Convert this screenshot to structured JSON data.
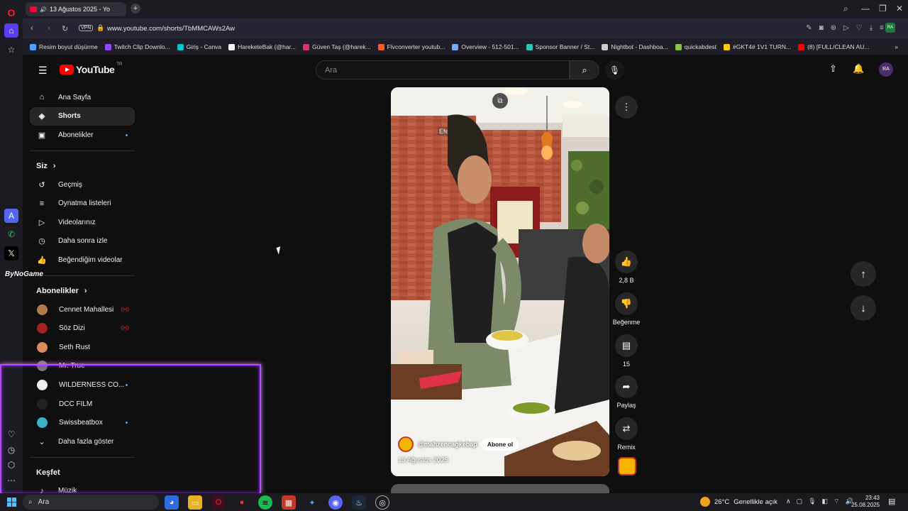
{
  "browser": {
    "tab_title": "13 Ağustos 2025 - Yo",
    "url": "www.youtube.com/shorts/TbMMCAWs2Aw",
    "vpn_label": "VPN",
    "bookmarks": [
      {
        "label": "Resim boyut düşürme",
        "color": "#4aa3ff"
      },
      {
        "label": "Twitch Clip Downlo...",
        "color": "#9146ff"
      },
      {
        "label": "Giriş - Canva",
        "color": "#00c4cc"
      },
      {
        "label": "HareketeBak (@har...",
        "color": "#ffffff"
      },
      {
        "label": "Güven Taş (@harek...",
        "color": "#e1306c"
      },
      {
        "label": "Flvconverter youtub...",
        "color": "#ff5a2a"
      },
      {
        "label": "Overview - 512-501...",
        "color": "#7aa8ff"
      },
      {
        "label": "Sponsor Banner / St...",
        "color": "#2ec4b6"
      },
      {
        "label": "Nightbot - Dashboa...",
        "color": "#cccccc"
      },
      {
        "label": "quickabdest",
        "color": "#8bc34a"
      },
      {
        "label": "#GKT4# 1V1 TURN...",
        "color": "#ffcc00"
      },
      {
        "label": "(8) [FULL/CLEAN AU...",
        "color": "#ff0000"
      }
    ]
  },
  "youtube": {
    "logo_text": "YouTube",
    "logo_region": "TR",
    "search_placeholder": "Ara",
    "avatar_initials": "RA",
    "sidebar": {
      "main": [
        {
          "label": "Ana Sayfa",
          "icon": "home-icon",
          "glyph": "⌂"
        },
        {
          "label": "Shorts",
          "icon": "shorts-icon",
          "glyph": "◈",
          "active": true
        },
        {
          "label": "Abonelikler",
          "icon": "subscriptions-icon",
          "glyph": "▣",
          "dot": true
        }
      ],
      "you_title": "Siz",
      "you": [
        {
          "label": "Geçmiş",
          "icon": "history-icon",
          "glyph": "↺"
        },
        {
          "label": "Oynatma listeleri",
          "icon": "playlists-icon",
          "glyph": "≡"
        },
        {
          "label": "Videolarınız",
          "icon": "your-videos-icon",
          "glyph": "▷"
        },
        {
          "label": "Daha sonra izle",
          "icon": "watch-later-icon",
          "glyph": "◷"
        },
        {
          "label": "Beğendiğim videolar",
          "icon": "liked-videos-icon",
          "glyph": "👍"
        }
      ],
      "subs_title": "Abonelikler",
      "subs": [
        {
          "label": "Cennet Mahallesi",
          "color": "#b07a4a",
          "live": true
        },
        {
          "label": "Söz Dizi",
          "color": "#a32020",
          "live": true
        },
        {
          "label": "Seth Rust",
          "color": "#d98c5f"
        },
        {
          "label": "Mr. True",
          "color": "#777777"
        },
        {
          "label": "WILDERNESS CO...",
          "color": "#eeeeee",
          "dot": true
        },
        {
          "label": "DCC FILM",
          "color": "#222222"
        },
        {
          "label": "Swissbeatbox",
          "color": "#3ab0c9",
          "dot": true
        }
      ],
      "show_more": "Daha fazla göster",
      "explore_title": "Keşfet",
      "explore": [
        {
          "label": "Müzik",
          "icon": "music-icon",
          "glyph": "♪"
        }
      ]
    },
    "short": {
      "channel": "@mahzencagkebap",
      "subscribe": "Abone ol",
      "date": "13 Ağustos 2025",
      "sign_text": "Efendi"
    },
    "actions": {
      "likes": "2,8 B",
      "dislike": "Beğenme",
      "comments": "15",
      "share": "Paylaş",
      "remix": "Remix"
    }
  },
  "overlay": {
    "handle": "ByNoGame"
  },
  "taskbar": {
    "search_placeholder": "Ara",
    "weather_temp": "26°C",
    "weather_desc": "Genellikle açık",
    "time": "23:43",
    "date": "25.08.2025"
  }
}
